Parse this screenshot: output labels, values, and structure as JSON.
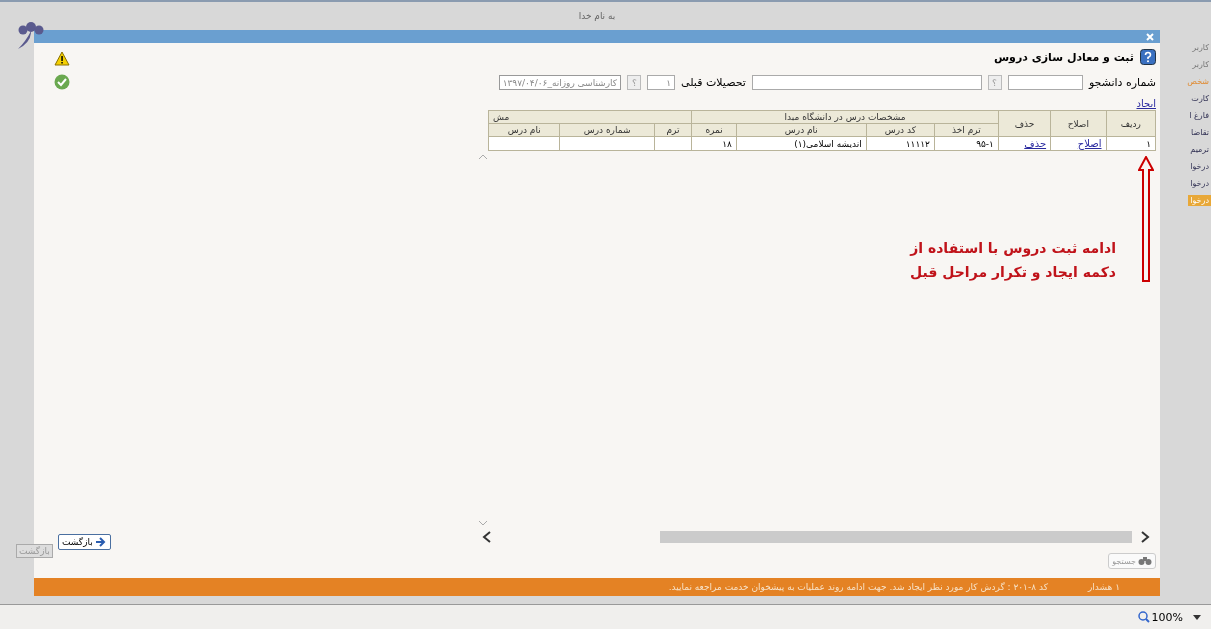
{
  "background_page": {
    "title": "به نام خدا",
    "sidebar_items": [
      {
        "label": "کاربر",
        "kind": "label",
        "selected": false
      },
      {
        "label": "کاربر",
        "kind": "label",
        "selected": false
      },
      {
        "label": "شخص",
        "kind": "heading",
        "selected": false
      },
      {
        "label": "کارت",
        "kind": "link",
        "selected": false
      },
      {
        "label": "فارغ ا",
        "kind": "link",
        "selected": false
      },
      {
        "label": "تقاضا",
        "kind": "link",
        "selected": false
      },
      {
        "label": "ترمیم",
        "kind": "link",
        "selected": false
      },
      {
        "label": "درخوا",
        "kind": "link",
        "selected": false
      },
      {
        "label": "درخوا",
        "kind": "link",
        "selected": false
      },
      {
        "label": "درخوا",
        "kind": "link",
        "selected": true
      }
    ],
    "back_button": "بازگشت"
  },
  "dialog": {
    "title": "ثبت و معادل سازی دروس",
    "form": {
      "student_number_label": "شماره دانشجو",
      "help_button": "؟",
      "previous_education_label": "تحصیلات قبلی",
      "previous_education_index": "۱",
      "previous_education_value": "کارشناسی روزانه_۱۳۹۷/۰۴/۰۶"
    },
    "create_link": "ایجاد",
    "table": {
      "group_header": "مشخصات درس در دانشگاه مبدا",
      "group_header_2": "مش",
      "columns": [
        "ردیف",
        "اصلاح",
        "حذف",
        "ترم اخذ",
        "کد درس",
        "نام درس",
        "نمره",
        "ترم",
        "شماره درس",
        "نام درس"
      ],
      "rows": [
        {
          "row_number": "۱",
          "edit_link": "اصلاح",
          "delete_link": "حذف",
          "term_taken": "۹۵-۱",
          "course_code": "۱۱۱۱۲",
          "course_name": "اندیشه اسلامی(۱)",
          "grade": "۱۸"
        }
      ]
    },
    "annotation": {
      "lines": [
        "ادامه ثبت دروس با استفاده از",
        "دکمه ایجاد و تکرار مراحل قبل"
      ]
    },
    "search_button": "جستجو",
    "back_button": "بازگشت",
    "status_bar": {
      "warning_count": "۱  هشدار",
      "message": "کد ۸-۲۰۱ : گردش کار مورد نظر ایجاد شد. جهت ادامه روند عملیات به پیشخوان خدمت مراجعه نمایید."
    }
  },
  "browser": {
    "zoom": "100%"
  }
}
